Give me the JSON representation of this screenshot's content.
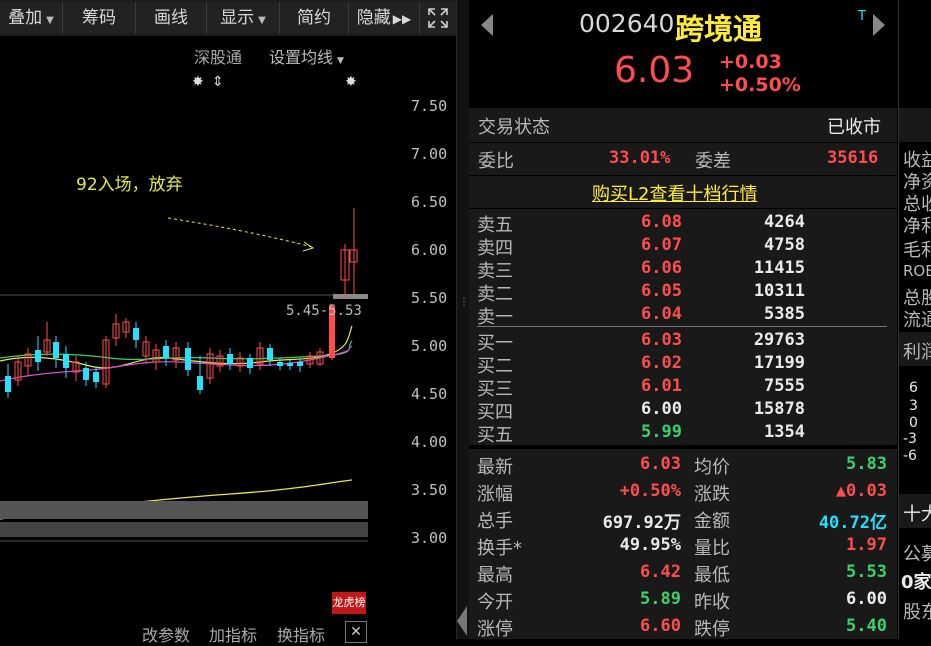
{
  "toolbar": {
    "overlay": "叠加",
    "chips": "筹码",
    "draw": "画线",
    "display": "显示",
    "compact": "简约",
    "hide": "隐藏"
  },
  "chart_header": {
    "sz_connect": "深股通",
    "set_ma": "设置均线"
  },
  "annotation": "92入场，放弃",
  "range_label": "5.45-5.53",
  "price_axis": [
    "7.50",
    "7.00",
    "6.50",
    "6.00",
    "5.50",
    "5.00",
    "4.50",
    "4.00",
    "3.50",
    "3.00"
  ],
  "bottom_tabs": {
    "params": "改参数",
    "add_indicator": "加指标",
    "switch_indicator": "换指标"
  },
  "badge": "龙虎榜",
  "stock": {
    "code": "002640",
    "name": "跨境通",
    "price": "6.03",
    "change": "+0.03",
    "change_pct": "+0.50%",
    "t_mark": "T"
  },
  "status": {
    "label": "交易状态",
    "value": "已收市"
  },
  "ratio": {
    "wb_label": "委比",
    "wb_value": "33.01%",
    "wc_label": "委差",
    "wc_value": "35616"
  },
  "l2_link": "购买L2查看十档行情",
  "asks": [
    {
      "label": "卖五",
      "price": "6.08",
      "vol": "4264"
    },
    {
      "label": "卖四",
      "price": "6.07",
      "vol": "4758"
    },
    {
      "label": "卖三",
      "price": "6.06",
      "vol": "11415"
    },
    {
      "label": "卖二",
      "price": "6.05",
      "vol": "10311"
    },
    {
      "label": "卖一",
      "price": "6.04",
      "vol": "5385"
    }
  ],
  "bids": [
    {
      "label": "买一",
      "price": "6.03",
      "vol": "29763"
    },
    {
      "label": "买二",
      "price": "6.02",
      "vol": "17199"
    },
    {
      "label": "买三",
      "price": "6.01",
      "vol": "7555"
    },
    {
      "label": "买四",
      "price": "6.00",
      "vol": "15878"
    },
    {
      "label": "买五",
      "price": "5.99",
      "vol": "1354"
    }
  ],
  "stats": [
    {
      "l1": "最新",
      "v1": "6.03",
      "c1": "red",
      "l2": "均价",
      "v2": "5.83",
      "c2": "green"
    },
    {
      "l1": "涨幅",
      "v1": "+0.50%",
      "c1": "red",
      "l2": "涨跌",
      "v2": "▲0.03",
      "c2": "red"
    },
    {
      "l1": "总手",
      "v1": "697.92万",
      "c1": "white",
      "l2": "金额",
      "v2": "40.72亿",
      "c2": "cyan"
    },
    {
      "l1": "换手*",
      "v1": "49.95%",
      "c1": "white",
      "l2": "量比",
      "v2": "1.97",
      "c2": "red"
    },
    {
      "l1": "最高",
      "v1": "6.42",
      "c1": "red",
      "l2": "最低",
      "v2": "5.53",
      "c2": "green"
    },
    {
      "l1": "今开",
      "v1": "5.89",
      "c1": "green",
      "l2": "昨收",
      "v2": "6.00",
      "c2": "white"
    },
    {
      "l1": "涨停",
      "v1": "6.60",
      "c1": "red",
      "l2": "跌停",
      "v2": "5.40",
      "c2": "green"
    }
  ],
  "far_panel": {
    "items": [
      "收益",
      "净资",
      "总收",
      "净利",
      "毛利",
      "ROE",
      "总股",
      "流通"
    ],
    "profit": "利润",
    "axis": [
      "6",
      "3",
      "0",
      "-3",
      "-6"
    ],
    "top10": "十大",
    "announce": "公募",
    "count": "0家",
    "shareholders": "股东"
  },
  "colors": {
    "up": "#ff4d4d",
    "down": "#39d36a",
    "cyan": "#27e0ff",
    "ma_yellow": "#e8e84a"
  }
}
